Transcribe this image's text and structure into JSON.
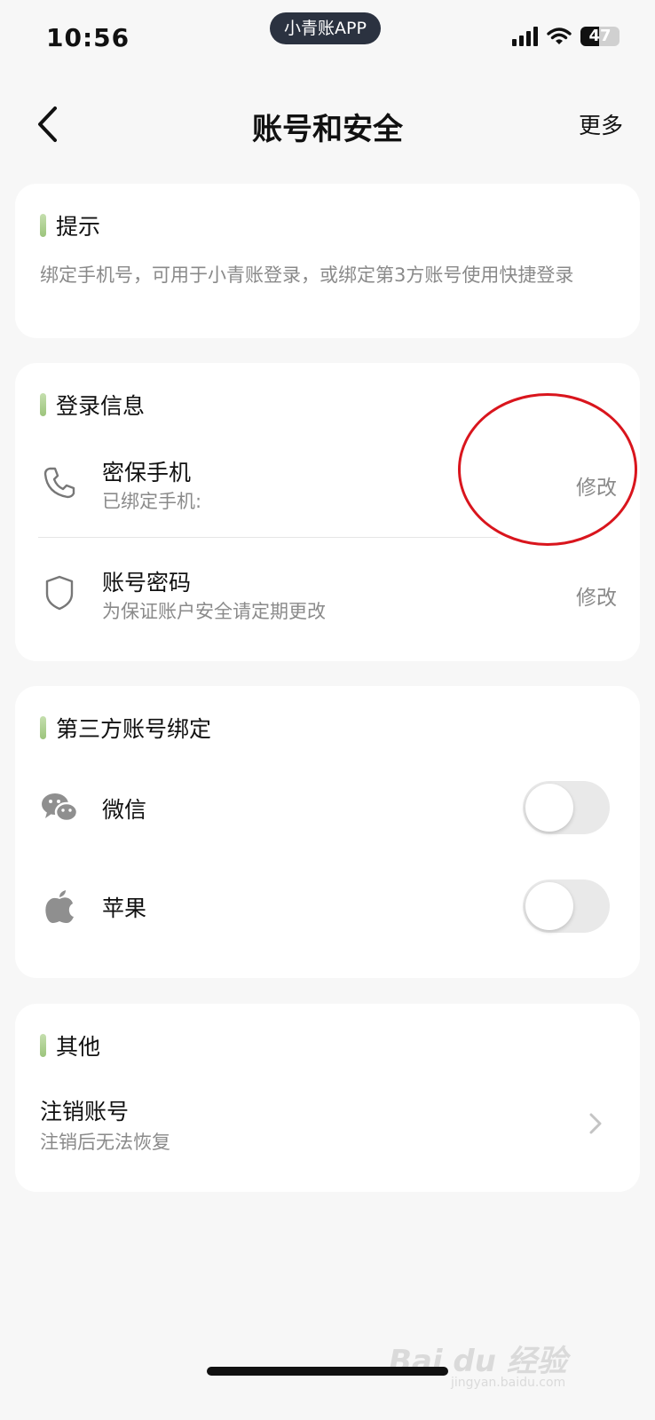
{
  "status_bar": {
    "time": "10:56",
    "app_label": "小青账APP",
    "battery_level": "47",
    "battery_fraction": 0.47
  },
  "nav": {
    "title": "账号和安全",
    "more_label": "更多"
  },
  "hint_card": {
    "title": "提示",
    "text": "绑定手机号，可用于小青账登录，或绑定第3方账号使用快捷登录"
  },
  "login_card": {
    "title": "登录信息",
    "phone": {
      "title": "密保手机",
      "subtitle": "已绑定手机:",
      "action": "修改",
      "icon": "phone-icon"
    },
    "password": {
      "title": "账号密码",
      "subtitle": "为保证账户安全请定期更改",
      "action": "修改",
      "icon": "shield-icon"
    }
  },
  "third_party_card": {
    "title": "第三方账号绑定",
    "wechat": {
      "label": "微信",
      "icon": "wechat-icon",
      "enabled": false
    },
    "apple": {
      "label": "苹果",
      "icon": "apple-icon",
      "enabled": false
    }
  },
  "other_card": {
    "title": "其他",
    "deactivate": {
      "title": "注销账号",
      "subtitle": "注销后无法恢复"
    }
  },
  "watermark": {
    "text": "Bai du 经验",
    "url": "jingyan.baidu.com"
  },
  "colors": {
    "accent": "#9cc47c",
    "annotation": "#d9151d",
    "muted_text": "#8a8a8a",
    "background": "#f7f7f7"
  }
}
